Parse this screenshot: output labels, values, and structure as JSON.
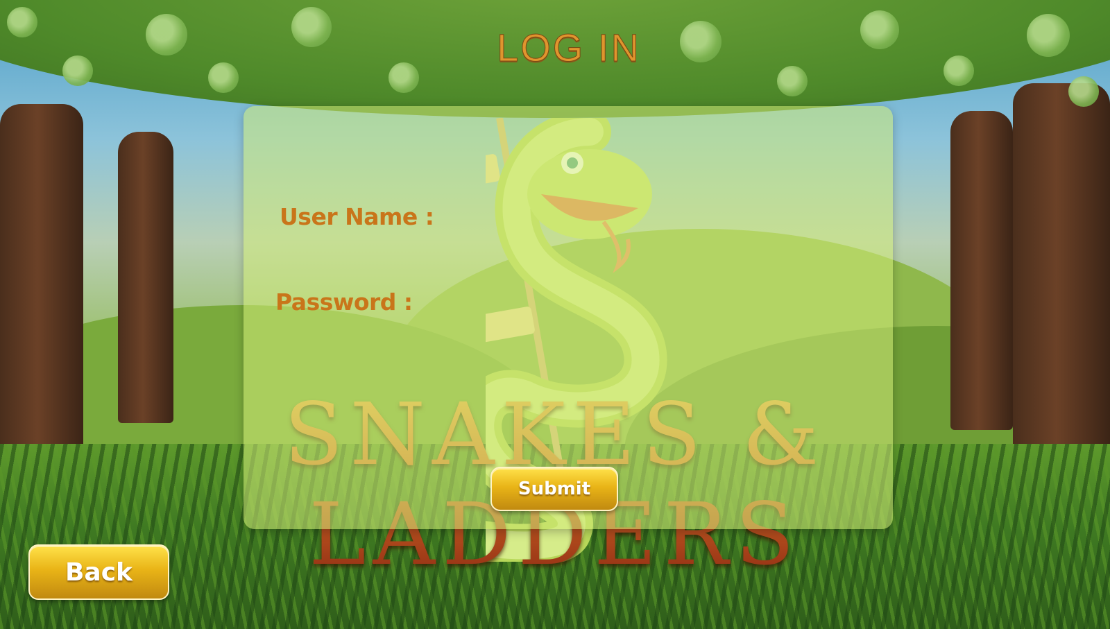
{
  "screen": {
    "title": "LOG IN",
    "brand_logo_text": "SNAKES & LADDERS"
  },
  "form": {
    "username_label": "User Name :",
    "username_value": "",
    "password_label": "Password :",
    "password_value": "",
    "submit_label": "Submit"
  },
  "nav": {
    "back_label": "Back"
  },
  "colors": {
    "label": "#c9751a",
    "title": "#e0952e",
    "button": "#e9b417",
    "panel": "#d2eb78"
  }
}
